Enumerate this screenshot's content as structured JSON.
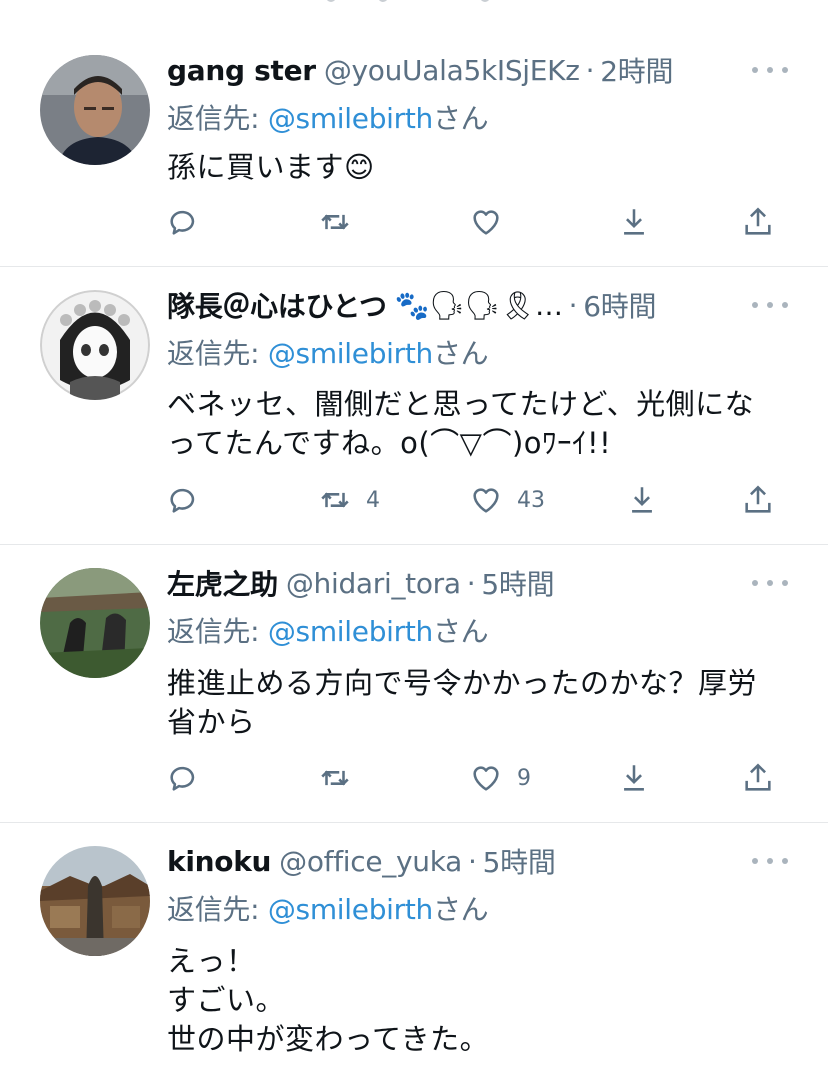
{
  "tweets": [
    {
      "name": "gang ster",
      "handle": "@youUala5kISjEKz",
      "time": "2時間",
      "reply_prefix": "返信先: ",
      "reply_mention": "@smilebirth",
      "reply_suffix": "さん",
      "body_lines": [
        "孫に買います😊"
      ],
      "retweets": "",
      "likes": ""
    },
    {
      "name": "隊長＠心はひとつ",
      "name_emoji": "🐾🗣🗣🎗…",
      "handle": "",
      "time": "6時間",
      "reply_prefix": "返信先: ",
      "reply_mention": "@smilebirth",
      "reply_suffix": "さん",
      "body_lines": [
        "ベネッセ、闇側だと思ってたけど、光側にな",
        "ってたんですね。o(⌒▽⌒)oﾜｰｲ!!"
      ],
      "retweets": "4",
      "likes": "43"
    },
    {
      "name": "左虎之助",
      "handle": "@hidari_tora",
      "time": "5時間",
      "reply_prefix": "返信先: ",
      "reply_mention": "@smilebirth",
      "reply_suffix": "さん",
      "body_lines": [
        "推進止める方向で号令かかったのかな？厚労",
        "省から"
      ],
      "retweets": "",
      "likes": "9"
    },
    {
      "name": "kinoku",
      "handle": "@office_yuka",
      "time": "5時間",
      "reply_prefix": "返信先: ",
      "reply_mention": "@smilebirth",
      "reply_suffix": "さん",
      "body_lines": [
        "えっ！",
        "すごい。",
        "世の中が変わってきた。"
      ]
    }
  ],
  "separator": "·",
  "icons": [
    "reply-icon",
    "retweet-icon",
    "like-icon",
    "download-icon",
    "share-icon",
    "more-icon"
  ],
  "colors": {
    "mention": "#2f8fd6",
    "secondary_text": "#5b7083",
    "primary_text": "#0f1419",
    "icon": "#5b7083"
  }
}
